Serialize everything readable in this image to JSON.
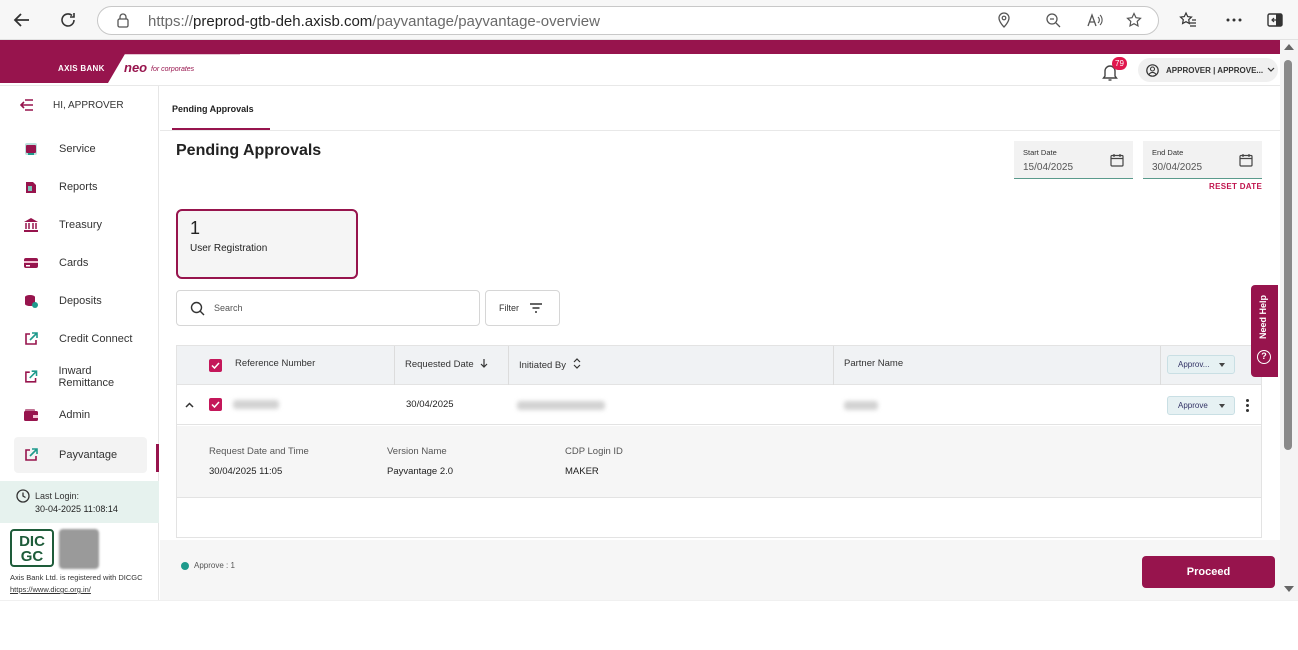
{
  "browser": {
    "url_prefix": "https://",
    "url_domain": "preprod-gtb-deh.axisb.com",
    "url_path": "/payvantage/payvantage-overview"
  },
  "header": {
    "bank_logo": "AXIS BANK",
    "product_logo": "neo",
    "product_tagline": "for corporates",
    "notification_count": "79",
    "user_label": "APPROVER | APPROVE..."
  },
  "sidebar": {
    "greeting": "HI, APPROVER",
    "items": [
      {
        "label": "Service",
        "icon": "service-icon"
      },
      {
        "label": "Reports",
        "icon": "reports-icon"
      },
      {
        "label": "Treasury",
        "icon": "bank-icon"
      },
      {
        "label": "Cards",
        "icon": "card-icon"
      },
      {
        "label": "Deposits",
        "icon": "deposits-icon"
      },
      {
        "label": "Credit Connect",
        "icon": "external-link-icon"
      },
      {
        "label": "Inward Remittance",
        "icon": "external-link-icon"
      },
      {
        "label": "Admin",
        "icon": "wallet-icon"
      },
      {
        "label": "Payvantage",
        "icon": "external-link-icon"
      }
    ],
    "active_item": "Payvantage",
    "last_login_label": "Last Login:",
    "last_login_value": "30-04-2025  11:08:14",
    "dicgc_logo_top": "DIC",
    "dicgc_logo_bottom": "GC",
    "dicgc_note": "Axis Bank Ltd. is registered with DICGC",
    "dicgc_link": "https://www.dicgc.org.in/"
  },
  "main": {
    "tab_label": "Pending Approvals",
    "page_title": "Pending Approvals",
    "start_date": {
      "label": "Start Date",
      "value": "15/04/2025"
    },
    "end_date": {
      "label": "End Date",
      "value": "30/04/2025"
    },
    "reset_date": "RESET DATE",
    "summary": {
      "count": "1",
      "label": "User Registration"
    },
    "search_placeholder": "Search",
    "filter_label": "Filter"
  },
  "table": {
    "columns": [
      "Reference Number",
      "Requested Date",
      "Initiated By",
      "Partner Name"
    ],
    "header_action": "Approv...",
    "rows": [
      {
        "requested_date": "30/04/2025",
        "action": "Approve",
        "details": [
          {
            "label": "Request Date and Time",
            "value": "30/04/2025 11:05"
          },
          {
            "label": "Version Name",
            "value": "Payvantage 2.0"
          },
          {
            "label": "CDP Login ID",
            "value": "MAKER"
          }
        ]
      }
    ]
  },
  "footer": {
    "legend": "Approve  :  1",
    "proceed_label": "Proceed"
  },
  "need_help": "Need Help",
  "colors": {
    "brand": "#97144d",
    "accent": "#c4175a",
    "approve_dot": "#1e9a8c"
  }
}
